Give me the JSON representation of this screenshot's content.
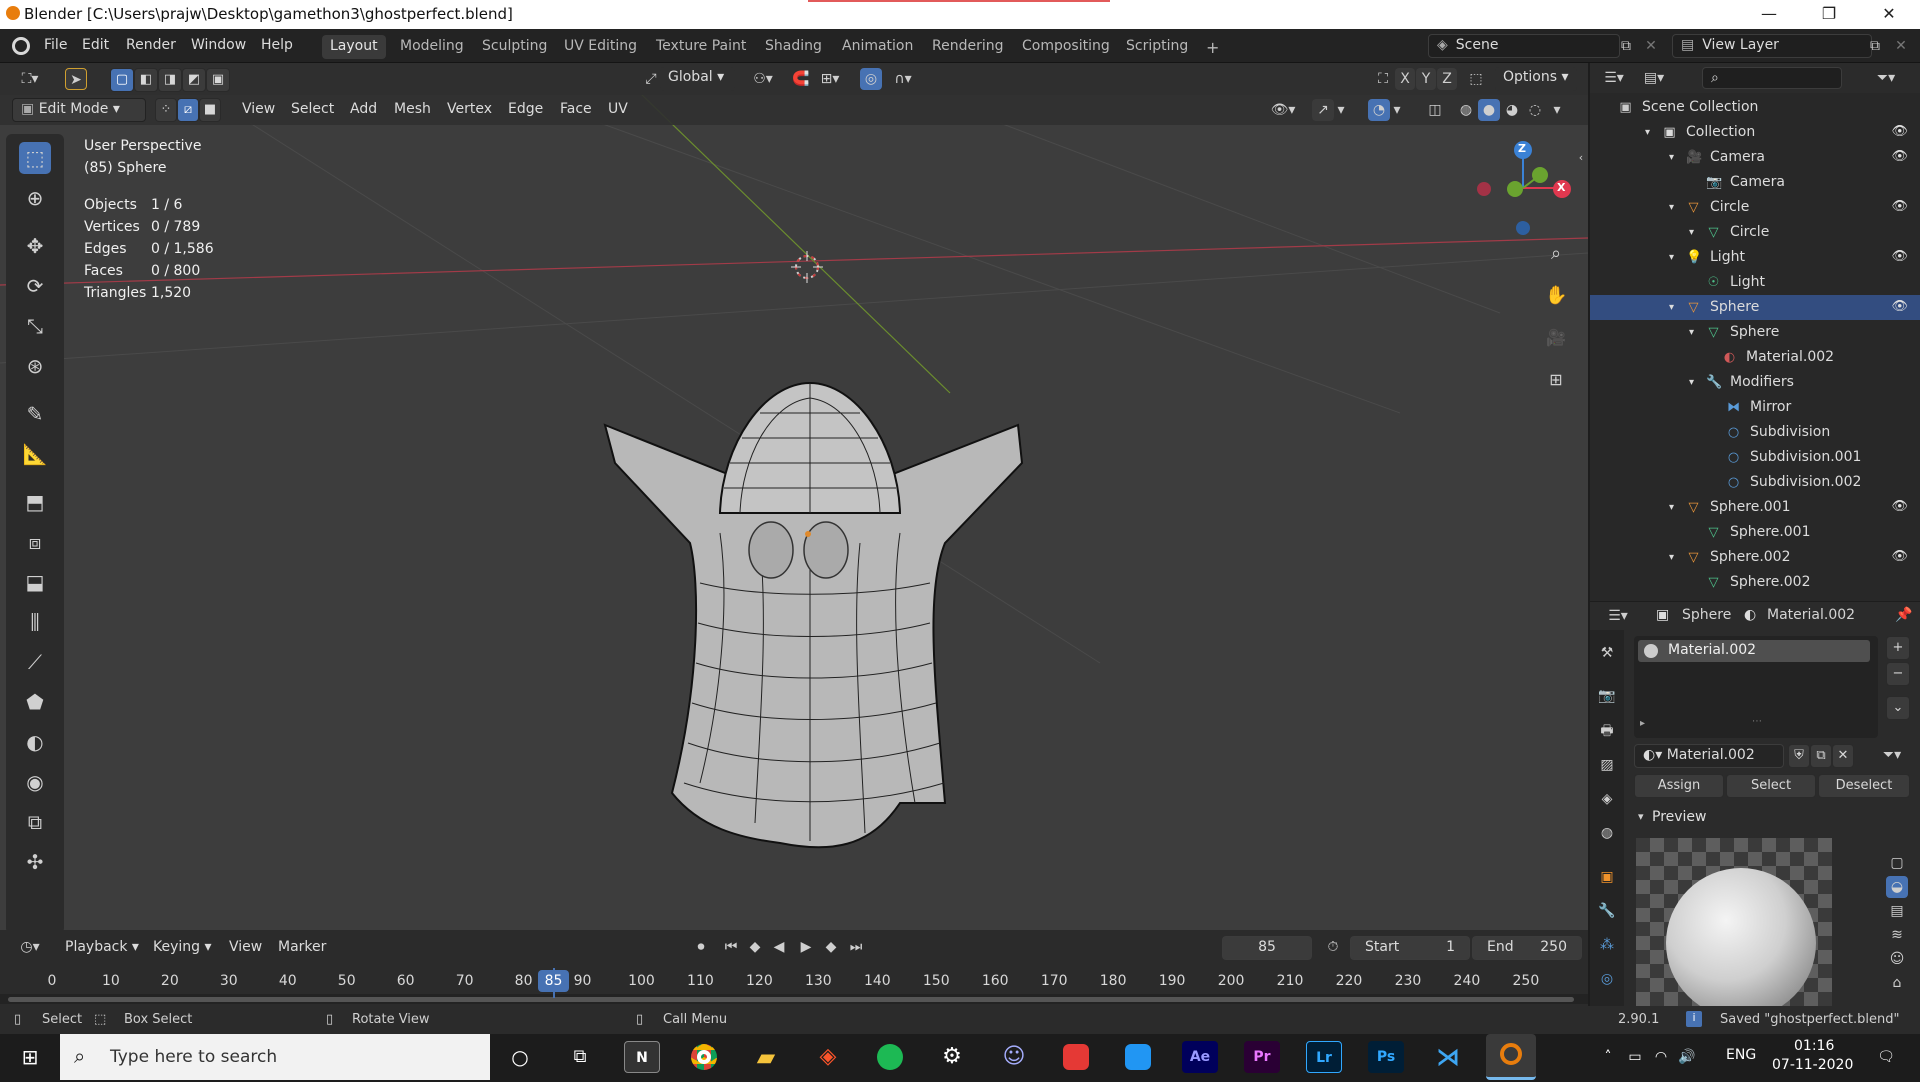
{
  "window": {
    "title": "Blender [C:\\Users\\prajw\\Desktop\\gamethon3\\ghostperfect.blend]",
    "minimize": "—",
    "maximize": "❐",
    "close": "✕"
  },
  "menu": [
    "File",
    "Edit",
    "Render",
    "Window",
    "Help"
  ],
  "workspaces": [
    {
      "label": "Layout",
      "active": true
    },
    {
      "label": "Modeling"
    },
    {
      "label": "Sculpting"
    },
    {
      "label": "UV Editing"
    },
    {
      "label": "Texture Paint"
    },
    {
      "label": "Shading"
    },
    {
      "label": "Animation"
    },
    {
      "label": "Rendering"
    },
    {
      "label": "Compositing"
    },
    {
      "label": "Scripting"
    }
  ],
  "add_workspace": "+",
  "scene": {
    "label": "Scene",
    "view_layer": "View Layer"
  },
  "viewport_header": {
    "transform_orientation": "Global",
    "options": "Options",
    "mode": "Edit Mode",
    "menus": [
      "View",
      "Select",
      "Add",
      "Mesh",
      "Vertex",
      "Edge",
      "Face",
      "UV"
    ],
    "axes": [
      "X",
      "Y",
      "Z"
    ]
  },
  "overlay_info": {
    "view": "User Perspective",
    "object": "(85) Sphere",
    "stats": [
      {
        "label": "Objects",
        "value": "1 / 6"
      },
      {
        "label": "Vertices",
        "value": "0 / 789"
      },
      {
        "label": "Edges",
        "value": "0 / 1,586"
      },
      {
        "label": "Faces",
        "value": "0 / 800"
      },
      {
        "label": "Triangles",
        "value": "1,520"
      }
    ]
  },
  "gizmo": {
    "z": "Z",
    "x": "X",
    "colors": {
      "x": "#e0384f",
      "y": "#6aa32f",
      "z": "#3b82d6"
    }
  },
  "outliner": {
    "root": "Scene Collection",
    "rows": [
      {
        "label": "Collection",
        "icon": "collection-icon",
        "eye": true
      },
      {
        "label": "Camera",
        "icon": "camera-object-icon",
        "eye": true
      },
      {
        "label": "Camera",
        "icon": "camera-data-icon"
      },
      {
        "label": "Circle",
        "icon": "mesh-object-icon",
        "eye": true
      },
      {
        "label": "Circle",
        "icon": "mesh-data-icon"
      },
      {
        "label": "Light",
        "icon": "light-object-icon",
        "eye": true
      },
      {
        "label": "Light",
        "icon": "light-data-icon"
      },
      {
        "label": "Sphere",
        "icon": "mesh-object-icon",
        "eye": true,
        "selected": true
      },
      {
        "label": "Sphere",
        "icon": "mesh-data-icon"
      },
      {
        "label": "Material.002",
        "icon": "material-icon"
      },
      {
        "label": "Modifiers",
        "icon": "wrench-icon"
      },
      {
        "label": "Mirror",
        "icon": "mirror-modifier-icon"
      },
      {
        "label": "Subdivision",
        "icon": "subdivision-icon"
      },
      {
        "label": "Subdivision.001",
        "icon": "subdivision-icon"
      },
      {
        "label": "Subdivision.002",
        "icon": "subdivision-icon"
      },
      {
        "label": "Sphere.001",
        "icon": "mesh-object-icon",
        "eye": true
      },
      {
        "label": "Sphere.001",
        "icon": "mesh-data-icon"
      },
      {
        "label": "Sphere.002",
        "icon": "mesh-object-icon",
        "eye": true
      },
      {
        "label": "Sphere.002",
        "icon": "mesh-data-icon"
      }
    ]
  },
  "properties": {
    "object": "Sphere",
    "material": "Material.002",
    "slot": "Material.002",
    "material_field": "Material.002",
    "assign": "Assign",
    "select": "Select",
    "deselect": "Deselect",
    "preview": "Preview"
  },
  "timeline": {
    "menus": [
      "Playback",
      "Keying",
      "View",
      "Marker"
    ],
    "current_frame": "85",
    "start_label": "Start",
    "start": "1",
    "end_label": "End",
    "end": "250",
    "ticks": [
      "0",
      "10",
      "20",
      "30",
      "40",
      "50",
      "60",
      "70",
      "80",
      "85",
      "90",
      "100",
      "110",
      "120",
      "130",
      "140",
      "150",
      "160",
      "170",
      "180",
      "190",
      "200",
      "210",
      "220",
      "230",
      "240",
      "250"
    ]
  },
  "statusbar": {
    "select": "Select",
    "box_select": "Box Select",
    "rotate_view": "Rotate View",
    "call_menu": "Call Menu",
    "version": "2.90.1",
    "saved": "Saved \"ghostperfect.blend\""
  },
  "taskbar": {
    "search_placeholder": "Type here to search",
    "apps": [
      "cortana-icon",
      "task-view-icon",
      "notion-icon",
      "chrome-icon",
      "file-explorer-icon",
      "brave-icon",
      "spotify-icon",
      "steam-icon",
      "discord-icon",
      "whatsapp-icon",
      "instagram-icon",
      "after-effects-icon",
      "premiere-icon",
      "lightroom-icon",
      "photoshop-icon",
      "vscode-icon",
      "blender-icon"
    ],
    "app_labels": {
      "ae": "Ae",
      "pr": "Pr",
      "lr": "Lr",
      "ps": "Ps",
      "notion": "N"
    },
    "lang": "ENG",
    "time": "01:16",
    "date": "07-11-2020"
  }
}
